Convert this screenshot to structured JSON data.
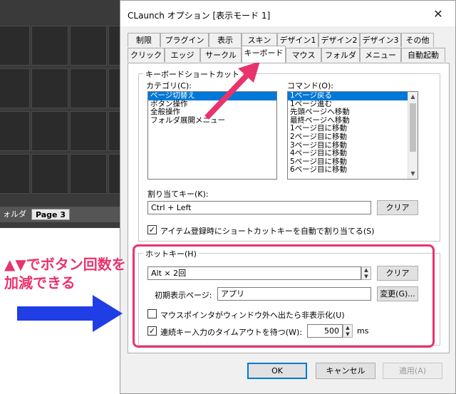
{
  "launcher": {
    "tabs": [
      "ォルダ",
      "Page 3"
    ]
  },
  "dialog": {
    "title": "CLaunch オプション [表示モード 1]",
    "tabs_row1": [
      "制限",
      "プラグイン",
      "表示",
      "スキン",
      "デザイン1",
      "デザイン2",
      "デザイン3",
      "その他"
    ],
    "tabs_row2": [
      "クリック",
      "エッジ",
      "サークル",
      "キーボード",
      "マウス",
      "フォルダ",
      "メニュー",
      "自動起動"
    ],
    "active_tab": "キーボード",
    "shortcut_group": {
      "label": "キーボードショートカット",
      "category_label": "カテゴリ(C):",
      "categories": [
        "ページ切替え",
        "ボタン操作",
        "全般操作",
        "フォルダ展開メニュー"
      ],
      "selected_category": 0,
      "command_label": "コマンド(O):",
      "commands": [
        "1ページ戻る",
        "1ページ進む",
        "先頭ページへ移動",
        "最終ページへ移動",
        "1ページ目に移動",
        "2ページ目に移動",
        "3ページ目に移動",
        "4ページ目に移動",
        "5ページ目に移動",
        "6ページ目に移動"
      ],
      "selected_command": 0,
      "assign_label": "割り当てキー(K):",
      "assign_value": "Ctrl + Left",
      "clear_label": "クリア",
      "auto_assign_label": "アイテム登録時にショートカットキーを自動で割り当てる(S)",
      "auto_assign_checked": true
    },
    "hotkey_group": {
      "label": "ホットキー(H)",
      "hotkey_value": "Alt × 2回",
      "clear_label": "クリア",
      "initial_page_label": "初期表示ページ:",
      "initial_page_value": "アプリ",
      "change_label": "変更(G)...",
      "hide_label": "マウスポインタがウィンドウ外へ出たら非表示化(U)",
      "hide_checked": false,
      "timeout_label": "連続キー入力のタイムアウトを待つ(W):",
      "timeout_checked": true,
      "timeout_value": "500",
      "timeout_unit": "ms"
    },
    "buttons": {
      "ok": "OK",
      "cancel": "キャンセル",
      "apply": "適用(A)"
    }
  },
  "annotation": {
    "text": "▲▼でボタン回数を加減できる",
    "color": "#e8336d",
    "arrow_color": "#1f3ee6"
  }
}
